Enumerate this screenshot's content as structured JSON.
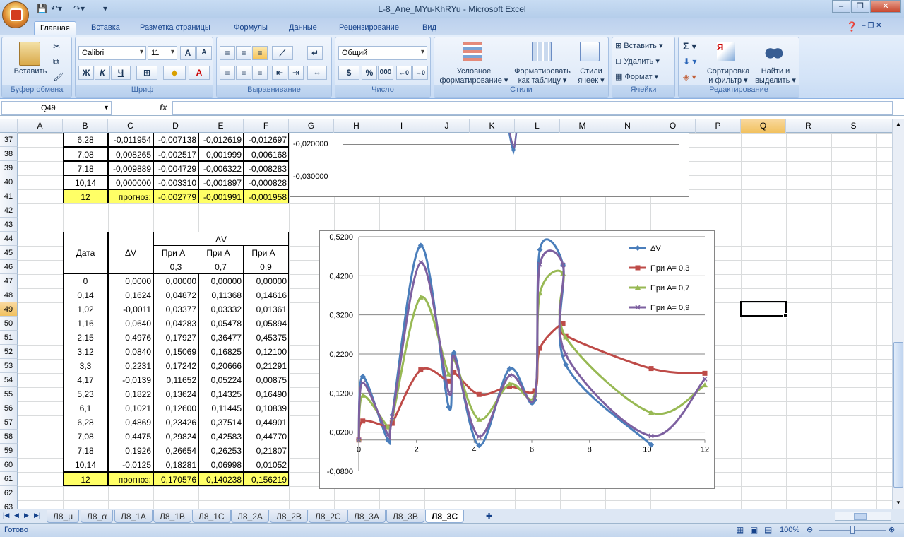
{
  "window": {
    "title": "L-8_Ane_MYu-KhRYu - Microsoft Excel"
  },
  "ribbon": {
    "tabs": [
      "Главная",
      "Вставка",
      "Разметка страницы",
      "Формулы",
      "Данные",
      "Рецензирование",
      "Вид"
    ],
    "active_tab": "Главная",
    "clipboard": {
      "paste": "Вставить",
      "label": "Буфер обмена"
    },
    "font": {
      "name": "Calibri",
      "size": "11",
      "bold": "Ж",
      "italic": "К",
      "underline": "Ч",
      "label": "Шрифт"
    },
    "alignment": {
      "label": "Выравнивание"
    },
    "number": {
      "format": "Общий",
      "label": "Число",
      "percent": "%",
      "thousands": "000"
    },
    "styles": {
      "cond": "Условное",
      "cond2": "форматирование",
      "table": "Форматировать",
      "table2": "как таблицу",
      "cell": "Стили",
      "cell2": "ячеек",
      "label": "Стили"
    },
    "cells": {
      "insert": "Вставить",
      "delete": "Удалить",
      "format": "Формат",
      "label": "Ячейки"
    },
    "editing": {
      "sort": "Сортировка",
      "sort2": "и фильтр",
      "find": "Найти и",
      "find2": "выделить",
      "label": "Редактирование"
    }
  },
  "formula_bar": {
    "name_box": "Q49",
    "fx": "fx",
    "formula": ""
  },
  "columns": [
    "A",
    "B",
    "C",
    "D",
    "E",
    "F",
    "G",
    "H",
    "I",
    "J",
    "K",
    "L",
    "M",
    "N",
    "O",
    "P",
    "Q",
    "R",
    "S"
  ],
  "selected_column": "Q",
  "rows": [
    "37",
    "38",
    "39",
    "40",
    "41",
    "42",
    "43",
    "44",
    "45",
    "46",
    "47",
    "48",
    "49",
    "50",
    "51",
    "52",
    "53",
    "54",
    "55",
    "56",
    "57",
    "58",
    "59",
    "60",
    "61",
    "62",
    "63"
  ],
  "selected_row": "49",
  "top_table": [
    [
      "6,28",
      "-0,011954",
      "-0,007138",
      "-0,012619",
      "-0,012697"
    ],
    [
      "7,08",
      "0,008265",
      "-0,002517",
      "0,001999",
      "0,006168"
    ],
    [
      "7,18",
      "-0,009889",
      "-0,004729",
      "-0,006322",
      "-0,008283"
    ],
    [
      "10,14",
      "0,000000",
      "-0,003310",
      "-0,001897",
      "-0,000828"
    ]
  ],
  "top_forecast": [
    "12",
    "прогноз:",
    "-0,002779",
    "-0,001991",
    "-0,001958"
  ],
  "table": {
    "h_date": "Дата",
    "h_dv": "ΔV",
    "h_group": "ΔV",
    "h_a1a": "При А=",
    "h_a1b": "0,3",
    "h_a2a": "При А=",
    "h_a2b": "0,7",
    "h_a3a": "При А=",
    "h_a3b": "0,9",
    "rows": [
      [
        "0",
        "0,0000",
        "0,00000",
        "0,00000",
        "0,00000"
      ],
      [
        "0,14",
        "0,1624",
        "0,04872",
        "0,11368",
        "0,14616"
      ],
      [
        "1,02",
        "-0,0011",
        "0,03377",
        "0,03332",
        "0,01361"
      ],
      [
        "1,16",
        "0,0640",
        "0,04283",
        "0,05478",
        "0,05894"
      ],
      [
        "2,15",
        "0,4976",
        "0,17927",
        "0,36477",
        "0,45375"
      ],
      [
        "3,12",
        "0,0840",
        "0,15069",
        "0,16825",
        "0,12100"
      ],
      [
        "3,3",
        "0,2231",
        "0,17242",
        "0,20666",
        "0,21291"
      ],
      [
        "4,17",
        "-0,0139",
        "0,11652",
        "0,05224",
        "0,00875"
      ],
      [
        "5,23",
        "0,1822",
        "0,13624",
        "0,14325",
        "0,16490"
      ],
      [
        "6,1",
        "0,1021",
        "0,12600",
        "0,11445",
        "0,10839"
      ],
      [
        "6,28",
        "0,4869",
        "0,23426",
        "0,37514",
        "0,44901"
      ],
      [
        "7,08",
        "0,4475",
        "0,29824",
        "0,42583",
        "0,44770"
      ],
      [
        "7,18",
        "0,1926",
        "0,26654",
        "0,26253",
        "0,21807"
      ],
      [
        "10,14",
        "-0,0125",
        "0,18281",
        "0,06998",
        "0,01052"
      ]
    ],
    "forecast": [
      "12",
      "прогноз:",
      "0,170576",
      "0,140238",
      "0,156219"
    ]
  },
  "chart_top": {
    "ticks": [
      "-0,020000",
      "-0,030000"
    ]
  },
  "chart_data": {
    "type": "scatter",
    "title": "",
    "x": [
      0,
      0.14,
      1.02,
      1.16,
      2.15,
      3.12,
      3.3,
      4.17,
      5.23,
      6.1,
      6.28,
      7.08,
      7.18,
      10.14,
      12
    ],
    "xlim": [
      0,
      12
    ],
    "ylim": [
      -0.08,
      0.52
    ],
    "xticks": [
      "0",
      "2",
      "4",
      "6",
      "8",
      "10",
      "12"
    ],
    "yticks": [
      "-0,0800",
      "0,0200",
      "0,1200",
      "0,2200",
      "0,3200",
      "0,4200",
      "0,5200"
    ],
    "series": [
      {
        "name": "ΔV",
        "color": "#4a7ebb",
        "marker": "diamond",
        "values": [
          0,
          0.1624,
          -0.0011,
          0.064,
          0.4976,
          0.084,
          0.2231,
          -0.0139,
          0.1822,
          0.1021,
          0.4869,
          0.4475,
          0.1926,
          -0.0125,
          null
        ]
      },
      {
        "name": "При А= 0,3",
        "color": "#be4b48",
        "marker": "square",
        "values": [
          0,
          0.04872,
          0.03377,
          0.04283,
          0.17927,
          0.15069,
          0.17242,
          0.11652,
          0.13624,
          0.126,
          0.23426,
          0.29824,
          0.26654,
          0.18281,
          0.170576
        ]
      },
      {
        "name": "При А= 0,7",
        "color": "#98b954",
        "marker": "triangle",
        "values": [
          0,
          0.11368,
          0.03332,
          0.05478,
          0.36477,
          0.16825,
          0.20666,
          0.05224,
          0.14325,
          0.11445,
          0.37514,
          0.42583,
          0.26253,
          0.06998,
          0.140238
        ]
      },
      {
        "name": "При А= 0,9",
        "color": "#7d60a0",
        "marker": "x",
        "values": [
          0,
          0.14616,
          0.01361,
          0.05894,
          0.45375,
          0.121,
          0.21291,
          0.00875,
          0.1649,
          0.10839,
          0.44901,
          0.4477,
          0.21807,
          0.01052,
          0.156219
        ]
      }
    ],
    "legend": "top-right",
    "grid": true
  },
  "sheets": [
    "Л8_μ",
    "Л8_α",
    "Л8_1А",
    "Л8_1В",
    "Л8_1С",
    "Л8_2А",
    "Л8_2В",
    "Л8_2С",
    "Л8_3А",
    "Л8_3В",
    "Л8_3С"
  ],
  "active_sheet": "Л8_3С",
  "status": {
    "ready": "Готово",
    "zoom": "100%"
  }
}
